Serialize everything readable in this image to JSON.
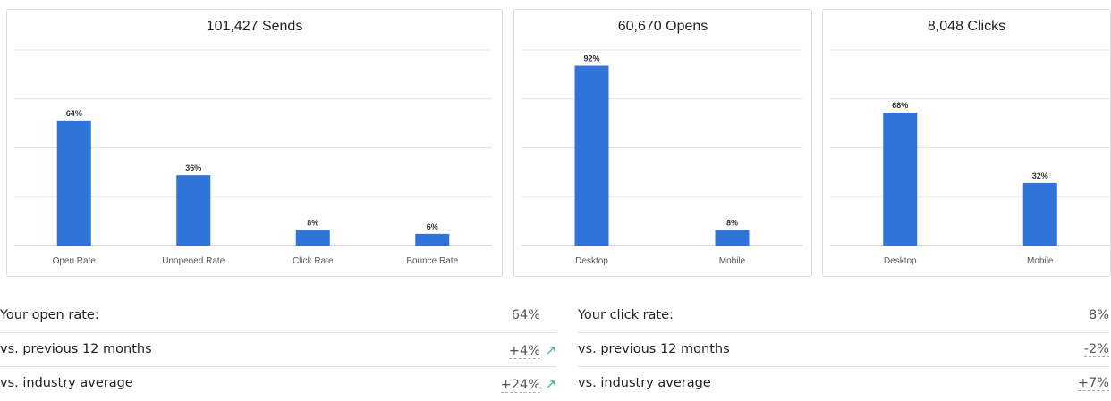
{
  "colors": {
    "bar": "#2f74d8",
    "arrow_up": "#3fb6a8"
  },
  "chart_data": [
    {
      "type": "bar",
      "title": "101,427 Sends",
      "categories": [
        "Open Rate",
        "Unopened Rate",
        "Click Rate",
        "Bounce Rate"
      ],
      "values": [
        64,
        36,
        8,
        6
      ],
      "value_labels": [
        "64%",
        "36%",
        "8%",
        "6%"
      ],
      "ylim": [
        0,
        100
      ],
      "grid": true
    },
    {
      "type": "bar",
      "title": "60,670 Opens",
      "categories": [
        "Desktop",
        "Mobile"
      ],
      "values": [
        92,
        8
      ],
      "value_labels": [
        "92%",
        "8%"
      ],
      "ylim": [
        0,
        100
      ],
      "grid": true
    },
    {
      "type": "bar",
      "title": "8,048 Clicks",
      "categories": [
        "Desktop",
        "Mobile"
      ],
      "values": [
        68,
        32
      ],
      "value_labels": [
        "68%",
        "32%"
      ],
      "ylim": [
        0,
        100
      ],
      "grid": true
    }
  ],
  "open_stats": {
    "rows": [
      {
        "label": "Your open rate:",
        "value": "64%",
        "icon": ""
      },
      {
        "label": "vs. previous 12 months",
        "value": "+4%",
        "icon": "arrow-up-right-icon"
      },
      {
        "label": "vs. industry average",
        "value": "+24%",
        "icon": "arrow-up-right-icon"
      }
    ]
  },
  "click_stats": {
    "rows": [
      {
        "label": "Your click rate:",
        "value": "8%",
        "icon": ""
      },
      {
        "label": "vs. previous 12 months",
        "value": "-2%",
        "icon": ""
      },
      {
        "label": "vs. industry average",
        "value": "+7%",
        "icon": ""
      }
    ]
  }
}
